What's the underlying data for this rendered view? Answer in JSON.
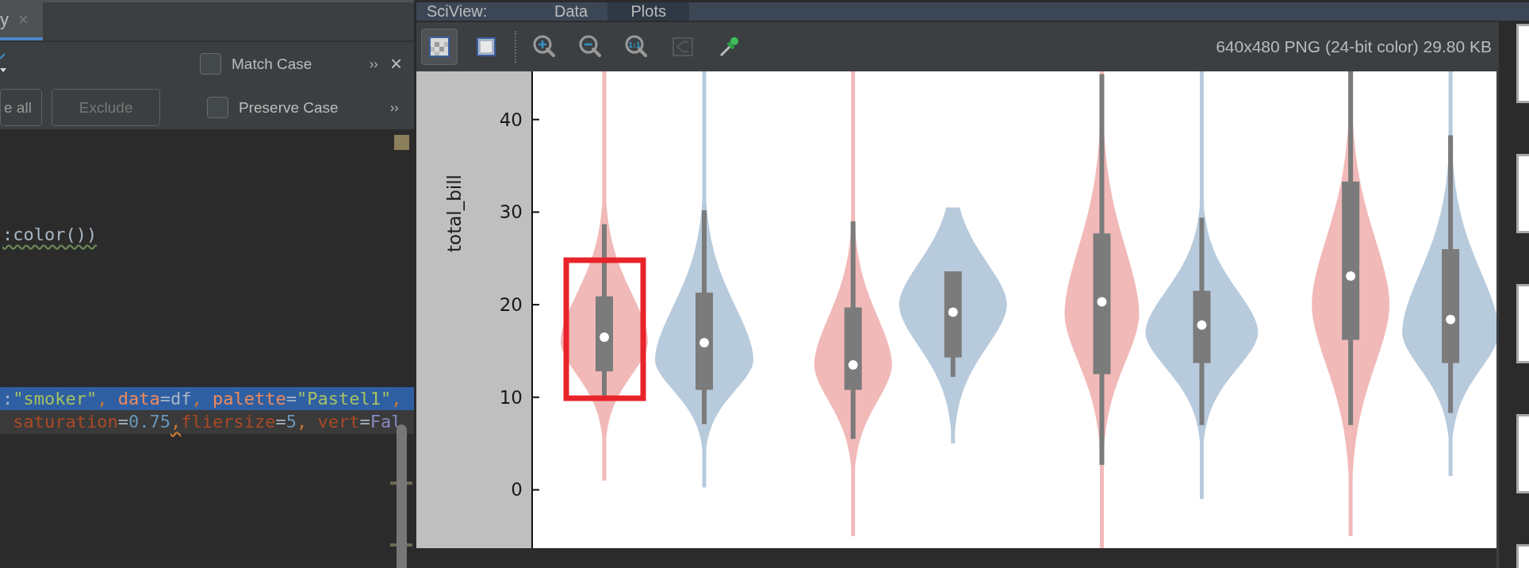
{
  "editor_tab": {
    "label": "y",
    "close": "×",
    "selected": true
  },
  "find_bar": {
    "options": [
      {
        "label": "Match Case",
        "checked": false,
        "more": "››"
      },
      {
        "label": "Preserve Case",
        "checked": false,
        "more": "››"
      }
    ],
    "close": "×",
    "buttons": [
      {
        "label": "e all",
        "disabled": false
      },
      {
        "label": "Exclude",
        "disabled": true
      }
    ]
  },
  "code_lines": [
    {
      "selected": false,
      "current": false,
      "tokens": [
        {
          "kind": "plain",
          "text": ":color())",
          "typo": true
        }
      ]
    },
    {
      "selected": true,
      "current": false,
      "tokens": [
        {
          "kind": "op",
          "text": ":"
        },
        {
          "kind": "str",
          "text": "\"smoker\""
        },
        {
          "kind": "punct",
          "text": ", "
        },
        {
          "kind": "param",
          "text": "data"
        },
        {
          "kind": "op",
          "text": "=df"
        },
        {
          "kind": "punct",
          "text": ", "
        },
        {
          "kind": "param",
          "text": "palette"
        },
        {
          "kind": "op",
          "text": "="
        },
        {
          "kind": "str",
          "text": "\"Pastel1\""
        },
        {
          "kind": "punct",
          "text": ","
        }
      ]
    },
    {
      "selected": false,
      "current": true,
      "tokens": [
        {
          "kind": "param",
          "text": " saturation"
        },
        {
          "kind": "op",
          "text": "="
        },
        {
          "kind": "num",
          "text": "0.75"
        },
        {
          "kind": "punct",
          "text": ",",
          "weak_warning": true
        },
        {
          "kind": "param",
          "text": "fliersize"
        },
        {
          "kind": "op",
          "text": "="
        },
        {
          "kind": "num",
          "text": "5"
        },
        {
          "kind": "punct",
          "text": ", "
        },
        {
          "kind": "param",
          "text": "vert"
        },
        {
          "kind": "op",
          "text": "="
        },
        {
          "kind": "const",
          "text": "Fal"
        }
      ]
    }
  ],
  "sciview": {
    "title": "SciView:",
    "tabs": [
      {
        "label": "Data",
        "selected": false
      },
      {
        "label": "Plots",
        "selected": true
      }
    ],
    "toolbar": [
      {
        "kind": "chessboard",
        "selected": true,
        "disabled": false
      },
      {
        "kind": "frame",
        "selected": false,
        "disabled": false
      },
      {
        "kind": "zoomin",
        "selected": false,
        "disabled": false
      },
      {
        "kind": "zoomout",
        "selected": false,
        "disabled": false
      },
      {
        "kind": "actual",
        "label": "1:1",
        "selected": false,
        "disabled": false
      },
      {
        "kind": "tree",
        "selected": false,
        "disabled": true
      },
      {
        "kind": "dropper",
        "selected": false,
        "disabled": false
      }
    ],
    "image_info": "640x480 PNG (24-bit color) 29.80 KB",
    "plot": {
      "highlight": true,
      "ylabel": "total_bill",
      "ytick_labels": [
        "40",
        "30",
        "20",
        "10",
        "0"
      ]
    },
    "thumbnails": [
      {
        "selected": false
      },
      {
        "selected": false
      },
      {
        "selected": false
      },
      {
        "selected": false
      },
      {
        "selected": false
      }
    ]
  }
}
